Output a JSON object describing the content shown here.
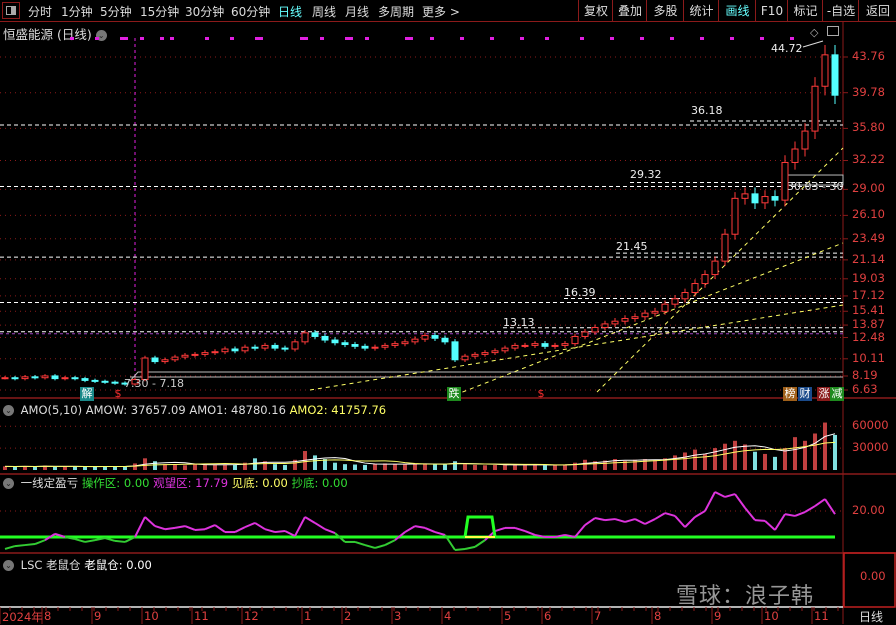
{
  "toolbar": {
    "periods": [
      "分时",
      "1分钟",
      "5分钟",
      "15分钟",
      "30分钟",
      "60分钟",
      "日线",
      "周线",
      "月线",
      "多周期",
      "更多 >"
    ],
    "active_period": "日线",
    "right_buttons": [
      "复权",
      "叠加",
      "多股",
      "统计",
      "画线",
      "F10",
      "标记",
      "-自选",
      "返回"
    ],
    "active_right": "画线"
  },
  "main": {
    "title": "恒盛能源 (日线)",
    "price_notes": {
      "high": "44.72",
      "l36": "36.18",
      "l29": "29.32",
      "l21": "21.45",
      "l16": "16.39",
      "l13": "13.13",
      "box": "30.03 - 30",
      "low": "7.30 - 7.18"
    },
    "signals": {
      "jie": "解",
      "dollar1": "$",
      "die": "跌",
      "dollar2": "$",
      "bang": "榜",
      "cai": "财",
      "zhang": "涨",
      "jian": "减"
    },
    "colors": {
      "up": "#ff3a3a",
      "down": "#54ffff",
      "grid": "#8b1a1a",
      "axis_text": "#e04040",
      "trend": "#ffff66",
      "level": "#ffffff",
      "marker": "#e020e0"
    }
  },
  "amo": {
    "title": "AMO(5,10)",
    "amow": "AMOW: 37657.09",
    "amo1": "AMO1: 48780.16",
    "amo2": "AMO2: 41757.76"
  },
  "ind": {
    "title": "一线定盈亏",
    "cao": "操作区: 0.00",
    "guan": "观望区: 17.79",
    "jian": "见底: 0.00",
    "chao": "抄底: 0.00"
  },
  "lsc": {
    "title": "LSC 老鼠仓",
    "value": "老鼠仓: 0.00",
    "axis": "0.00"
  },
  "footer": {
    "period": "日线",
    "watermark": "雪球：浪子韩"
  },
  "chart_data": [
    {
      "type": "candlestick",
      "title": "恒盛能源 (日线)",
      "y_axis_ticks": [
        "43.76",
        "39.78",
        "35.80",
        "32.22",
        "29.00",
        "26.10",
        "23.49",
        "21.14",
        "19.03",
        "17.12",
        "15.41",
        "13.87",
        "12.48",
        "10.11",
        "8.19",
        "6.63"
      ],
      "ylim": [
        6.63,
        43.76
      ],
      "grid": true,
      "x_ticks": [
        {
          "label": "2024年",
          "index": 0
        },
        {
          "label": "8",
          "index": 4
        },
        {
          "label": "9",
          "index": 9
        },
        {
          "label": "10",
          "index": 14
        },
        {
          "label": "11",
          "index": 19
        },
        {
          "label": "12",
          "index": 24
        },
        {
          "label": "1",
          "index": 30
        },
        {
          "label": "2",
          "index": 34
        },
        {
          "label": "3",
          "index": 39
        },
        {
          "label": "4",
          "index": 44
        },
        {
          "label": "5",
          "index": 50
        },
        {
          "label": "6",
          "index": 54
        },
        {
          "label": "7",
          "index": 59
        },
        {
          "label": "8",
          "index": 65
        },
        {
          "label": "9",
          "index": 71
        },
        {
          "label": "10",
          "index": 76
        },
        {
          "label": "11",
          "index": 81
        }
      ],
      "close": [
        8.0,
        7.9,
        8.1,
        8.0,
        8.2,
        7.9,
        8.0,
        7.9,
        7.7,
        7.6,
        7.5,
        7.4,
        7.3,
        7.8,
        10.2,
        9.8,
        10.0,
        10.3,
        10.5,
        10.6,
        10.8,
        10.9,
        11.2,
        11.0,
        11.4,
        11.3,
        11.6,
        11.3,
        11.2,
        12.0,
        13.0,
        12.6,
        12.2,
        11.9,
        11.7,
        11.5,
        11.3,
        11.4,
        11.6,
        11.8,
        12.0,
        12.3,
        12.7,
        12.4,
        12.0,
        10.0,
        10.4,
        10.6,
        10.8,
        11.0,
        11.3,
        11.6,
        11.6,
        11.8,
        11.5,
        11.6,
        11.8,
        12.6,
        13.1,
        13.6,
        14.0,
        14.3,
        14.6,
        14.8,
        15.2,
        15.4,
        16.2,
        16.8,
        17.5,
        18.5,
        19.5,
        21.0,
        24.0,
        28.0,
        28.5,
        27.5,
        28.2,
        27.8,
        32.0,
        33.5,
        35.5,
        40.5,
        44.0,
        39.5
      ],
      "levels": [
        36.18,
        29.32,
        21.45,
        16.39,
        13.13
      ],
      "high_mark": 44.72
    },
    {
      "type": "bar",
      "title": "AMO(5,10)",
      "y_axis_ticks": [
        "60000",
        "30000"
      ],
      "ylim": [
        0,
        65000
      ],
      "values": [
        5000,
        4500,
        5200,
        4800,
        6000,
        4200,
        5000,
        4600,
        4400,
        4800,
        5200,
        4600,
        5000,
        9000,
        16000,
        12000,
        8000,
        7000,
        6500,
        7500,
        8000,
        7000,
        7200,
        6800,
        10000,
        16000,
        12000,
        8000,
        7000,
        14000,
        26000,
        20000,
        15000,
        10000,
        8000,
        7500,
        7000,
        8500,
        9000,
        8000,
        7500,
        8500,
        9000,
        8000,
        7500,
        12000,
        8000,
        7000,
        6500,
        7000,
        7500,
        6800,
        7200,
        7000,
        6500,
        7000,
        7500,
        10000,
        14000,
        12000,
        13000,
        15000,
        12500,
        14000,
        15000,
        13500,
        16000,
        20000,
        24000,
        28000,
        22000,
        30000,
        36000,
        40000,
        35000,
        25000,
        22000,
        18000,
        30000,
        45000,
        40000,
        50000,
        65000,
        48000
      ]
    },
    {
      "type": "line",
      "title": "一线定盈亏",
      "y_axis_ticks": [
        "20.00"
      ],
      "threshold": 10,
      "values": [
        5.4,
        6.5,
        6.9,
        7.3,
        8.8,
        11.2,
        10,
        9.2,
        8.1,
        8.8,
        9.6,
        8.5,
        8.1,
        10,
        17.7,
        14.2,
        13,
        13.5,
        14.2,
        12.7,
        13,
        14.6,
        11.9,
        11.9,
        13.8,
        15.4,
        13,
        11.9,
        12.3,
        10.4,
        17.7,
        15.4,
        13,
        11.5,
        8.1,
        8.1,
        6.9,
        5.8,
        6.9,
        8.8,
        11.9,
        14.2,
        13.5,
        11.9,
        10.8,
        5,
        5.4,
        6.2,
        8.8,
        12.3,
        13.5,
        13.5,
        12.3,
        10.8,
        10,
        10,
        10.8,
        10,
        14.6,
        17.3,
        16.5,
        16.9,
        15.8,
        16.9,
        15,
        16.9,
        19.2,
        18.1,
        13.8,
        17.7,
        20,
        27.3,
        25.4,
        26.5,
        21.2,
        16.5,
        16.2,
        12.7,
        18.8,
        18.1,
        19.6,
        21.9,
        24.6,
        18.8
      ],
      "zones": [
        {
          "from": 46,
          "to": 49,
          "level": 17.7
        }
      ]
    }
  ]
}
